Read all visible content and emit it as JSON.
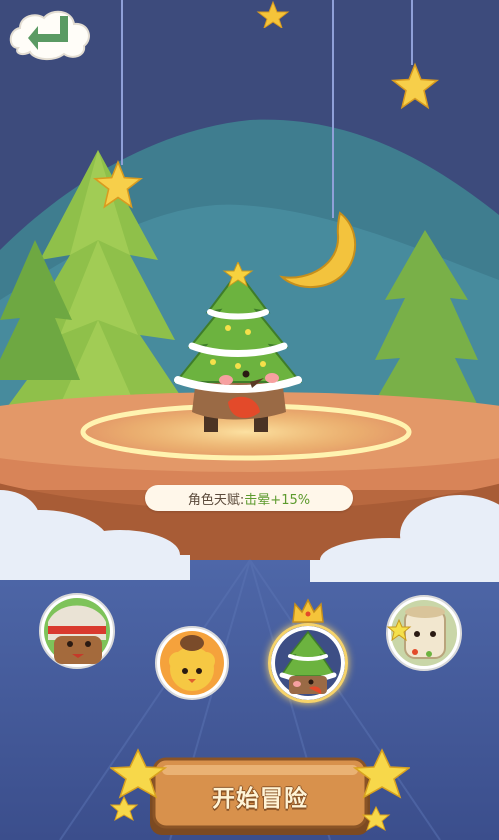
{
  "screen": {
    "talent_label": "角色天赋:",
    "talent_value": "击晕+15%"
  },
  "character_select": {
    "avatars": [
      {
        "name": "headband-warrior-character",
        "selected": false
      },
      {
        "name": "fluffy-yellow-character",
        "selected": false
      },
      {
        "name": "christmas-tree-character",
        "selected": true
      },
      {
        "name": "stump-character",
        "selected": false
      }
    ]
  },
  "start_button": {
    "label": "开始冒险"
  },
  "icons": {
    "back": "back-arrow-icon",
    "crown": "crown-icon",
    "star": "star-icon",
    "moon": "moon-icon"
  },
  "colors": {
    "background": "#3e4f84",
    "hill": "#3f7d8f",
    "stage_wood": "#d88458",
    "back_arrow": "#5a9a63",
    "talent_value": "#5c9a2d",
    "button_wood": "#d8914c"
  }
}
